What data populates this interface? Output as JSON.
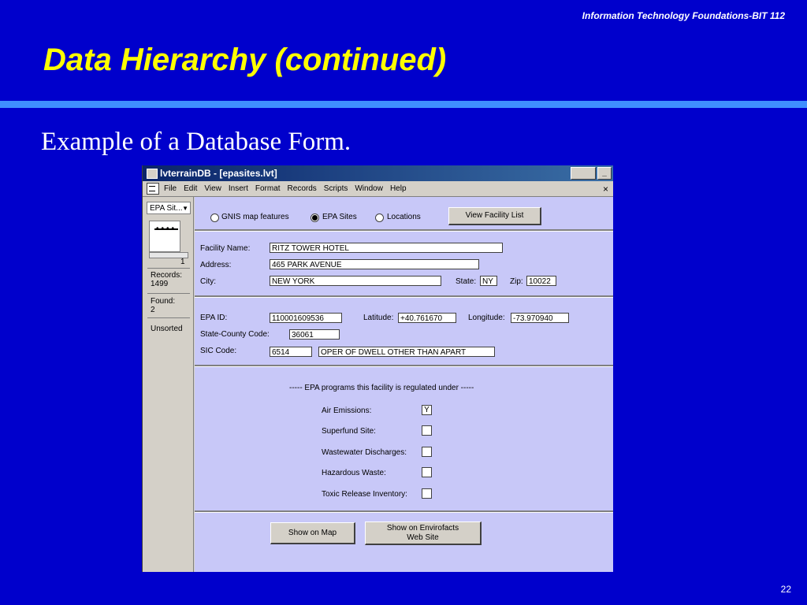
{
  "slide": {
    "course": "Information Technology Foundations-BIT 112",
    "title": "Data Hierarchy (continued)",
    "subtitle": "Example of a Database Form.",
    "page_number": "22"
  },
  "window": {
    "title": "lvterrainDB - [epasites.lvt]",
    "menu": [
      "File",
      "Edit",
      "View",
      "Insert",
      "Format",
      "Records",
      "Scripts",
      "Window",
      "Help"
    ],
    "close_glyph": "×"
  },
  "status": {
    "layout": "EPA Sit...",
    "current_record": "1",
    "records_label": "Records:",
    "records_value": "1499",
    "found_label": "Found:",
    "found_value": "2",
    "sort_state": "Unsorted"
  },
  "form": {
    "radio_options": [
      {
        "label": "GNIS map features",
        "selected": false
      },
      {
        "label": "EPA Sites",
        "selected": true
      },
      {
        "label": "Locations",
        "selected": false
      }
    ],
    "view_list_button": "View Facility List",
    "facility_name_label": "Facility Name:",
    "facility_name": "RITZ TOWER HOTEL",
    "address_label": "Address:",
    "address": "465 PARK AVENUE",
    "city_label": "City:",
    "city": "NEW YORK",
    "state_label": "State:",
    "state": "NY",
    "zip_label": "Zip:",
    "zip": "10022",
    "epa_id_label": "EPA ID:",
    "epa_id": "110001609536",
    "latitude_label": "Latitude:",
    "latitude": "+40.761670",
    "longitude_label": "Longitude:",
    "longitude": "-73.970940",
    "county_code_label": "State-County Code:",
    "county_code": "36061",
    "sic_label": "SIC Code:",
    "sic_code": "6514",
    "sic_desc": "OPER OF DWELL OTHER THAN APART",
    "programs_heading": "-----  EPA programs this facility is regulated under  -----",
    "programs": [
      {
        "label": "Air Emissions:",
        "value": "Y"
      },
      {
        "label": "Superfund Site:",
        "value": ""
      },
      {
        "label": "Wastewater Discharges:",
        "value": ""
      },
      {
        "label": "Hazardous Waste:",
        "value": ""
      },
      {
        "label": "Toxic Release Inventory:",
        "value": ""
      }
    ],
    "show_map_button": "Show on Map",
    "envirofacts_button_line1": "Show on Envirofacts",
    "envirofacts_button_line2": "Web Site"
  }
}
